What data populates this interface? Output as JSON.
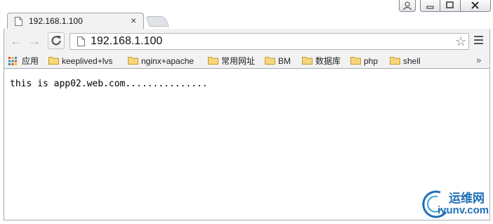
{
  "tab": {
    "title": "192.168.1.100",
    "close_glyph": "×"
  },
  "toolbar": {
    "back_glyph": "←",
    "forward_glyph": "→",
    "url": "192.168.1.100",
    "star_glyph": "☆"
  },
  "bookmarks": {
    "apps_label": "应用",
    "items": [
      {
        "label": "keeplived+lvs"
      },
      {
        "label": "nginx+apache"
      },
      {
        "label": "常用网址"
      },
      {
        "label": "BM"
      },
      {
        "label": "数据库"
      },
      {
        "label": "php"
      },
      {
        "label": "shell"
      }
    ],
    "more_glyph": "»"
  },
  "page": {
    "text": "this is app02.web.com..............."
  },
  "watermark": {
    "cn": "运维网",
    "en": "iyunv.com"
  },
  "colors": {
    "chrome_bg": "#f2f2f2",
    "folder": "#f6d77b",
    "watermark": "#1f6fb5"
  }
}
